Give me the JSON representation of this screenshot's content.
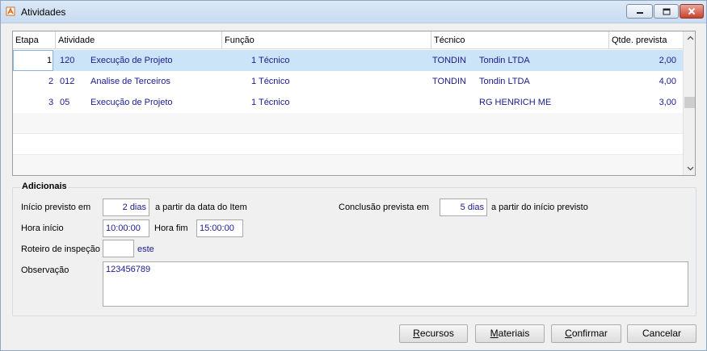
{
  "window": {
    "title": "Atividades"
  },
  "grid": {
    "columns": [
      "Etapa",
      "Atividade",
      "Função",
      "Técnico",
      "Qtde. prevista"
    ],
    "rows": [
      {
        "etapa": "1",
        "codigo": "120",
        "atividade": "Execução de Projeto",
        "funcao": "1 Técnico",
        "tecnico_cod": "TONDIN",
        "tecnico_nome": "Tondin LTDA",
        "qtde": "2,00"
      },
      {
        "etapa": "2",
        "codigo": "012",
        "atividade": "Analise de Terceiros",
        "funcao": "1 Técnico",
        "tecnico_cod": "TONDIN",
        "tecnico_nome": "Tondin LTDA",
        "qtde": "4,00"
      },
      {
        "etapa": "3",
        "codigo": "05",
        "atividade": "Execução de Projeto",
        "funcao": "1 Técnico",
        "tecnico_cod": "",
        "tecnico_nome": "RG HENRICH ME",
        "qtde": "3,00"
      }
    ]
  },
  "adicionais": {
    "group_title": "Adicionais",
    "inicio_label": "Início previsto em",
    "inicio_value": "2 dias",
    "inicio_suffix": "a partir da data do Item",
    "conclusao_label": "Conclusão prevista em",
    "conclusao_value": "5 dias",
    "conclusao_suffix": "a partir do início previsto",
    "hora_inicio_label": "Hora início",
    "hora_inicio_value": "10:00:00",
    "hora_fim_label": "Hora fim",
    "hora_fim_value": "15:00:00",
    "roteiro_label": "Roteiro de inspeção",
    "roteiro_value": "",
    "roteiro_desc": "este",
    "observacao_label": "Observação",
    "observacao_value": "123456789"
  },
  "buttons": {
    "recursos": {
      "pre": "",
      "ul": "R",
      "post": "ecursos"
    },
    "materiais": {
      "pre": "",
      "ul": "M",
      "post": "ateriais"
    },
    "confirmar": {
      "pre": "",
      "ul": "C",
      "post": "onfirmar"
    },
    "cancelar": "Cancelar"
  },
  "colors": {
    "selected_row": "#cce4f7",
    "text_blue": "#1a1a8c",
    "close_button": "#c8412c"
  },
  "icons": {
    "app": "app-logo-icon",
    "minimize": "minimize-icon",
    "maximize": "maximize-icon",
    "close": "close-icon",
    "scroll_up": "chevron-up-icon",
    "scroll_down": "chevron-down-icon"
  }
}
